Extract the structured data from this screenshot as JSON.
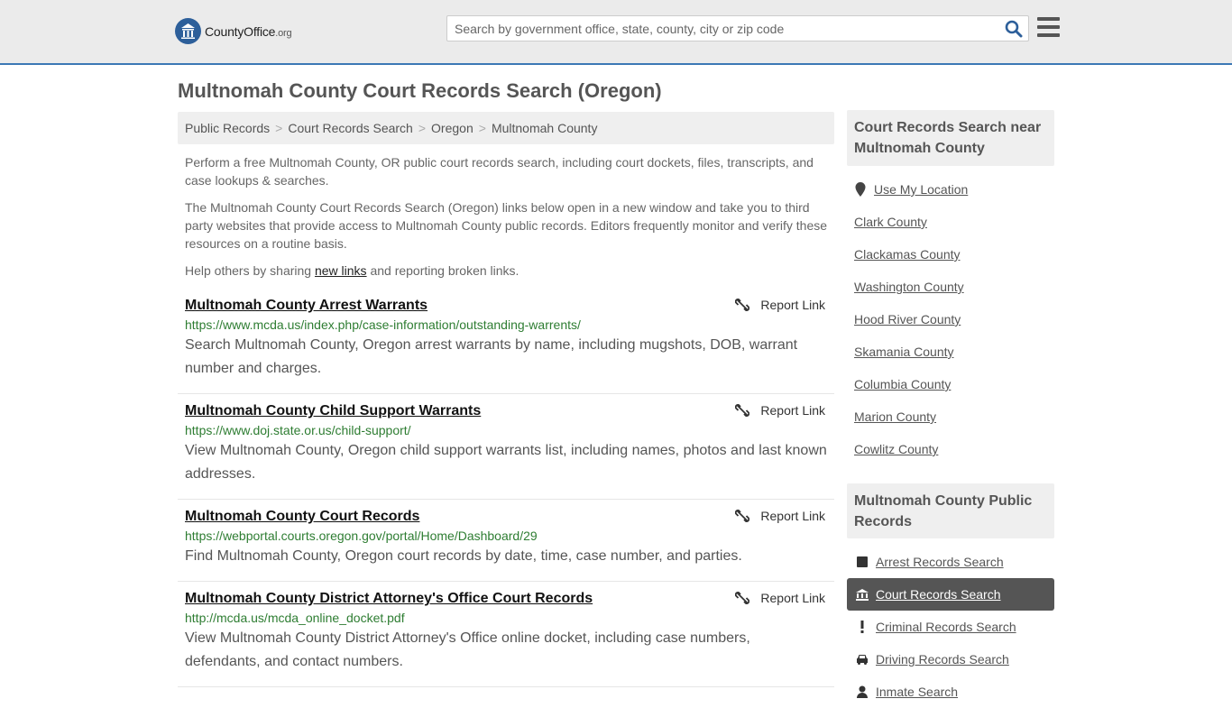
{
  "header": {
    "logo_text": "CountyOffice",
    "logo_suffix": ".org",
    "search_placeholder": "Search by government office, state, county, city or zip code"
  },
  "page_title": "Multnomah County Court Records Search (Oregon)",
  "breadcrumb": [
    "Public Records",
    "Court Records Search",
    "Oregon",
    "Multnomah County"
  ],
  "intro": {
    "p1": "Perform a free Multnomah County, OR public court records search, including court dockets, files, transcripts, and case lookups & searches.",
    "p2": "The Multnomah County Court Records Search (Oregon) links below open in a new window and take you to third party websites that provide access to Multnomah County public records. Editors frequently monitor and verify these resources on a routine basis.",
    "p3_before": "Help others by sharing ",
    "p3_link": "new links",
    "p3_after": " and reporting broken links."
  },
  "report_label": "Report Link",
  "results": [
    {
      "title": "Multnomah County Arrest Warrants",
      "url": "https://www.mcda.us/index.php/case-information/outstanding-warrents/",
      "desc": "Search Multnomah County, Oregon arrest warrants by name, including mugshots, DOB, warrant number and charges."
    },
    {
      "title": "Multnomah County Child Support Warrants",
      "url": "https://www.doj.state.or.us/child-support/",
      "desc": "View Multnomah County, Oregon child support warrants list, including names, photos and last known addresses."
    },
    {
      "title": "Multnomah County Court Records",
      "url": "https://webportal.courts.oregon.gov/portal/Home/Dashboard/29",
      "desc": "Find Multnomah County, Oregon court records by date, time, case number, and parties."
    },
    {
      "title": "Multnomah County District Attorney's Office Court Records",
      "url": "http://mcda.us/mcda_online_docket.pdf",
      "desc": "View Multnomah County District Attorney's Office online docket, including case numbers, defendants, and contact numbers."
    }
  ],
  "sidebar": {
    "nearby_heading": "Court Records Search near Multnomah County",
    "use_location": "Use My Location",
    "nearby": [
      "Clark County",
      "Clackamas County",
      "Washington County",
      "Hood River County",
      "Skamania County",
      "Columbia County",
      "Marion County",
      "Cowlitz County"
    ],
    "public_heading": "Multnomah County Public Records",
    "public_items": [
      {
        "label": "Arrest Records Search",
        "icon": "square-icon"
      },
      {
        "label": "Court Records Search",
        "icon": "courthouse-icon"
      },
      {
        "label": "Criminal Records Search",
        "icon": "exclamation-icon"
      },
      {
        "label": "Driving Records Search",
        "icon": "car-icon"
      },
      {
        "label": "Inmate Search",
        "icon": "inmate-icon"
      }
    ]
  },
  "colors": {
    "accent": "#3c78b5",
    "url_green": "#2e7d32",
    "active_bg": "#555555"
  }
}
